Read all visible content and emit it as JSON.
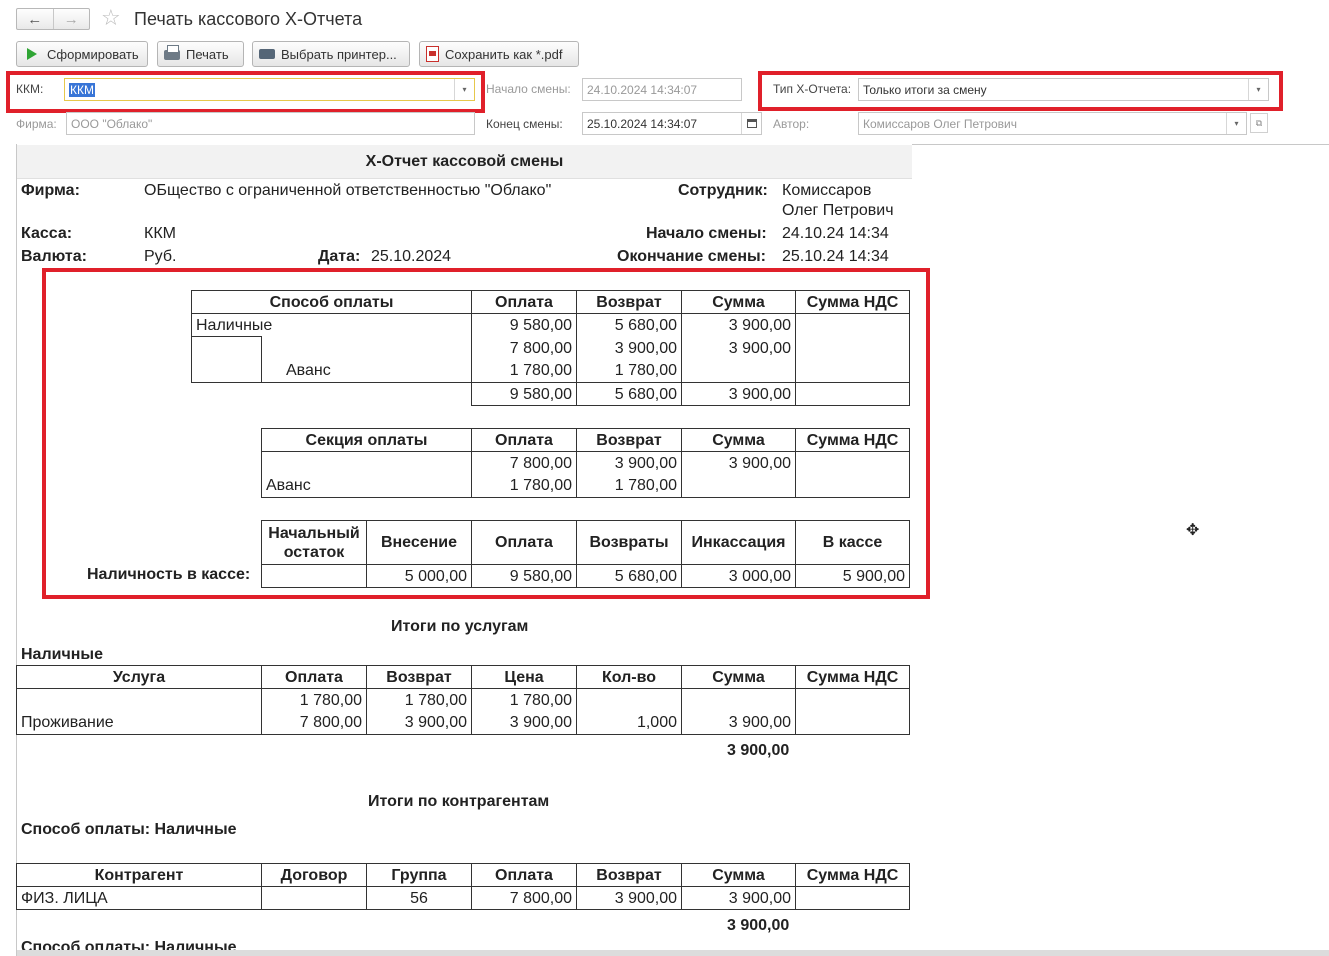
{
  "window": {
    "title": "Печать кассового Х-Отчета"
  },
  "toolbar": {
    "generate": "Сформировать",
    "print": "Печать",
    "select_printer": "Выбрать принтер...",
    "save_pdf": "Сохранить как *.pdf"
  },
  "form": {
    "kkm_label": "ККМ:",
    "kkm_value": "ККМ",
    "shift_start_label": "Начало смены:",
    "shift_start_value": "24.10.2024 14:34:07",
    "report_type_label": "Тип Х-Отчета:",
    "report_type_value": "Только итоги за смену",
    "firm_label": "Фирма:",
    "firm_value": "ООО \"Облако\"",
    "shift_end_label": "Конец смены:",
    "shift_end_value": "25.10.2024 14:34:07",
    "author_label": "Автор:",
    "author_value": "Комиссаров Олег Петрович"
  },
  "report": {
    "title": "Х-Отчет кассовой смены",
    "firm_label": "Фирма:",
    "firm_value": "ОБщество с ограниченной ответственностью \"Облако\"",
    "employee_label": "Сотрудник:",
    "employee_line1": "Комиссаров",
    "employee_line2": "Олег Петрович",
    "kassa_label": "Касса:",
    "kassa_value": "ККМ",
    "shift_start_label": "Начало смены:",
    "shift_start_value": "24.10.24 14:34",
    "currency_label": "Валюта:",
    "currency_value": "Руб.",
    "date_label": "Дата:",
    "date_value": "25.10.2024",
    "shift_end_label": "Окончание смены:",
    "shift_end_value": "25.10.24 14:34",
    "payment_table": {
      "headers": [
        "Способ оплаты",
        "Оплата",
        "Возврат",
        "Сумма",
        "Сумма НДС"
      ],
      "method": "Наличные",
      "sub_label": "Аванс",
      "rows": [
        [
          "9 580,00",
          "5 680,00",
          "3 900,00",
          ""
        ],
        [
          "7 800,00",
          "3 900,00",
          "3 900,00",
          ""
        ],
        [
          "1 780,00",
          "1 780,00",
          "",
          ""
        ]
      ],
      "total": [
        "9 580,00",
        "5 680,00",
        "3 900,00",
        ""
      ]
    },
    "section_table": {
      "headers": [
        "Секция оплаты",
        "Оплата",
        "Возврат",
        "Сумма",
        "Сумма НДС"
      ],
      "sub_label": "Аванс",
      "rows": [
        [
          "7 800,00",
          "3 900,00",
          "3 900,00",
          ""
        ],
        [
          "1 780,00",
          "1 780,00",
          "",
          ""
        ]
      ]
    },
    "cash_table": {
      "row_label": "Наличность в кассе:",
      "header_start_line1": "Начальный",
      "header_start_line2": "остаток",
      "headers": [
        "Внесение",
        "Оплата",
        "Возвраты",
        "Инкассация",
        "В кассе"
      ],
      "values": [
        "",
        "5 000,00",
        "9 580,00",
        "5 680,00",
        "3 000,00",
        "5 900,00"
      ]
    },
    "services": {
      "title": "Итоги по услугам",
      "method": "Наличные",
      "headers": [
        "Услуга",
        "Оплата",
        "Возврат",
        "Цена",
        "Кол-во",
        "Сумма",
        "Сумма НДС"
      ],
      "rows": [
        [
          "",
          "1 780,00",
          "1 780,00",
          "1 780,00",
          "",
          "",
          ""
        ],
        [
          "Проживание",
          "7 800,00",
          "3 900,00",
          "3 900,00",
          "1,000",
          "3 900,00",
          ""
        ]
      ],
      "total": "3 900,00"
    },
    "contragents": {
      "title": "Итоги по контрагентам",
      "method_label": "Способ оплаты: Наличные",
      "headers": [
        "Контрагент",
        "Договор",
        "Группа",
        "Оплата",
        "Возврат",
        "Сумма",
        "Сумма НДС"
      ],
      "rows": [
        [
          "ФИЗ. ЛИЦА",
          "",
          "56",
          "7 800,00",
          "3 900,00",
          "3 900,00",
          ""
        ]
      ],
      "total": "3 900,00",
      "next_method_label": "Способ оплаты: Наличные"
    }
  }
}
